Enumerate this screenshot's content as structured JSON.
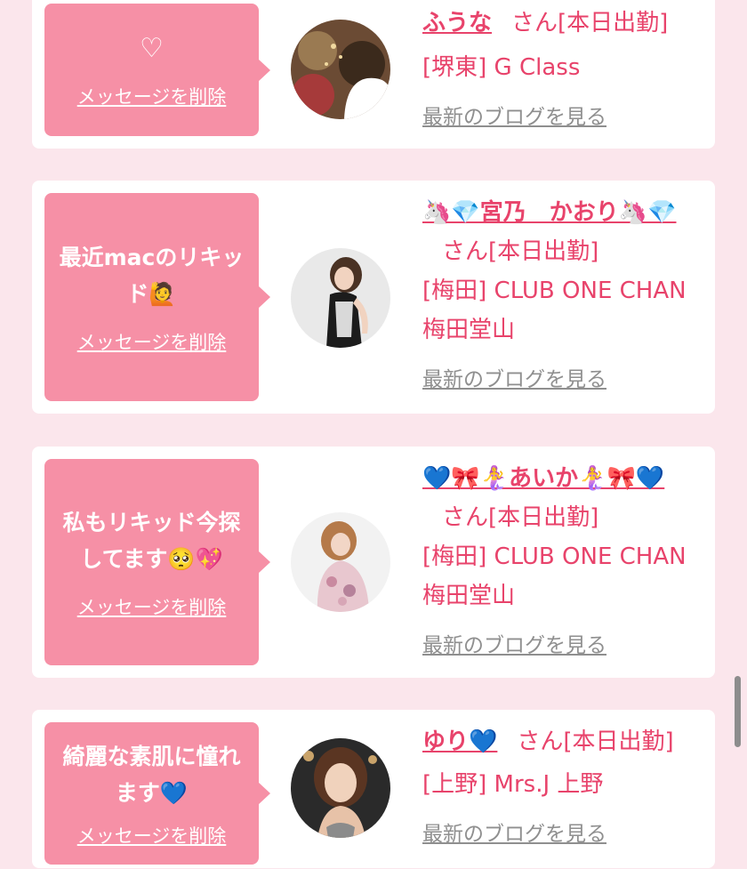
{
  "colors": {
    "page_background": "#fbe6ec",
    "card_background": "#ffffff",
    "bubble": "#f690a6",
    "accent_text": "#e8436b",
    "muted_link": "#8f8f8f"
  },
  "cards": [
    {
      "message": "♡",
      "delete_label": "メッセージを削除",
      "avatar_icon": "profile-photo",
      "name": "ふうな",
      "san_label": "さん[本日出勤]",
      "shop": "[堺東] G Class",
      "blog_label": "最新のブログを見る"
    },
    {
      "message": "最近macのリキッド🙋",
      "delete_label": "メッセージを削除",
      "avatar_icon": "profile-photo",
      "name": "🦄💎宮乃　かおり🦄💎",
      "san_label": "さん[本日出勤]",
      "shop": "[梅田] CLUB ONE CHAN 梅田堂山",
      "blog_label": "最新のブログを見る"
    },
    {
      "message": "私もリキッド今探してます🥺💖",
      "delete_label": "メッセージを削除",
      "avatar_icon": "profile-photo",
      "name": "💙🎀🧜‍♀️あいか🧜‍♀️🎀💙",
      "san_label": "さん[本日出勤]",
      "shop": "[梅田] CLUB ONE CHAN 梅田堂山",
      "blog_label": "最新のブログを見る"
    },
    {
      "message": "綺麗な素肌に憧れます💙",
      "delete_label": "メッセージを削除",
      "avatar_icon": "profile-photo",
      "name": "ゆり💙",
      "san_label": "さん[本日出勤]",
      "shop": "[上野] Mrs.J 上野",
      "blog_label": "最新のブログを見る"
    }
  ]
}
